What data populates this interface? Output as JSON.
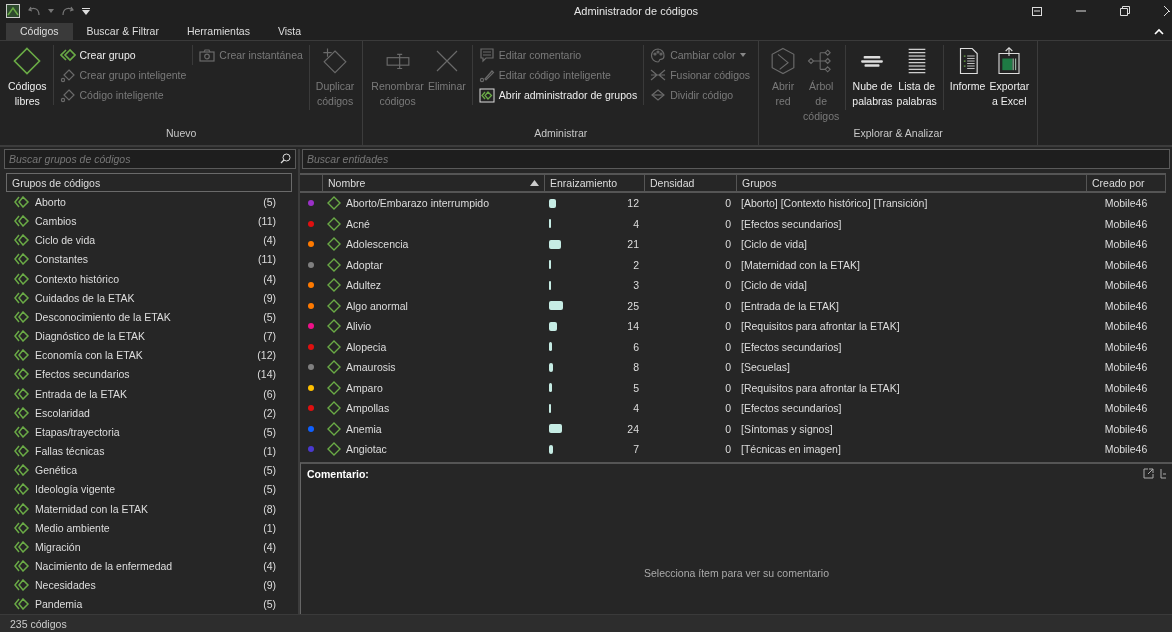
{
  "window": {
    "title": "Administrador de códigos"
  },
  "tabs": [
    {
      "label": "Códigos",
      "selected": true
    },
    {
      "label": "Buscar & Filtrar",
      "selected": false
    },
    {
      "label": "Herramientas",
      "selected": false
    },
    {
      "label": "Vista",
      "selected": false
    }
  ],
  "ribbon": [
    {
      "label": "Nuevo",
      "columns": [
        {
          "kind": "large",
          "items": [
            {
              "label": "Códigos libres",
              "disabled": false
            }
          ]
        },
        {
          "kind": "stack",
          "items": [
            {
              "label": "Crear grupo",
              "disabled": false
            },
            {
              "label": "Crear grupo inteligente",
              "disabled": true
            },
            {
              "label": "Código inteligente",
              "disabled": true
            }
          ]
        },
        {
          "kind": "stack",
          "items": [
            {
              "label": "Crear instantánea",
              "disabled": true
            }
          ]
        },
        {
          "kind": "large",
          "items": [
            {
              "label": "Duplicar códigos",
              "disabled": true
            }
          ]
        }
      ]
    },
    {
      "label": "Administrar",
      "columns": [
        {
          "kind": "large",
          "items": [
            {
              "label": "Renombrar códigos",
              "disabled": true
            },
            {
              "label": "Eliminar",
              "disabled": true
            }
          ]
        },
        {
          "kind": "stack",
          "items": [
            {
              "label": "Editar comentario",
              "disabled": true
            },
            {
              "label": "Editar código inteligente",
              "disabled": true
            },
            {
              "label": "Abrir administrador de grupos",
              "disabled": false
            }
          ]
        },
        {
          "kind": "stack",
          "items": [
            {
              "label": "Cambiar color",
              "disabled": true,
              "dropdown": true
            },
            {
              "label": "Fusionar códigos",
              "disabled": true
            },
            {
              "label": "Dividir código",
              "disabled": true
            }
          ]
        }
      ]
    },
    {
      "label": "Explorar & Analizar",
      "columns": [
        {
          "kind": "large",
          "items": [
            {
              "label": "Abrir red",
              "disabled": true
            },
            {
              "label": "Árbol de códigos",
              "disabled": true
            }
          ]
        },
        {
          "kind": "large",
          "items": [
            {
              "label": "Nube de palabras",
              "disabled": false
            },
            {
              "label": "Lista de palabras",
              "disabled": false
            }
          ]
        },
        {
          "kind": "large",
          "items": [
            {
              "label": "Informe",
              "disabled": false
            },
            {
              "label": "Exportar a Excel",
              "disabled": false
            }
          ]
        }
      ]
    }
  ],
  "groups_panel": {
    "search": {
      "placeholder": "Buscar grupos de códigos"
    },
    "header": "Grupos de códigos",
    "items": [
      {
        "name": "Aborto",
        "count": "(5)"
      },
      {
        "name": "Cambios",
        "count": "(11)"
      },
      {
        "name": "Ciclo de vida",
        "count": "(4)"
      },
      {
        "name": "Constantes",
        "count": "(11)"
      },
      {
        "name": "Contexto histórico",
        "count": "(4)"
      },
      {
        "name": "Cuidados de la ETAK",
        "count": "(9)"
      },
      {
        "name": "Desconocimiento de la ETAK",
        "count": "(5)"
      },
      {
        "name": "Diagnóstico de la ETAK",
        "count": "(7)"
      },
      {
        "name": "Economía con la ETAK",
        "count": "(12)"
      },
      {
        "name": "Efectos secundarios",
        "count": "(14)"
      },
      {
        "name": "Entrada de la ETAK",
        "count": "(6)"
      },
      {
        "name": "Escolaridad",
        "count": "(2)"
      },
      {
        "name": "Etapas/trayectoria",
        "count": "(5)"
      },
      {
        "name": "Fallas técnicas",
        "count": "(1)"
      },
      {
        "name": "Genética",
        "count": "(5)"
      },
      {
        "name": "Ideología vigente",
        "count": "(5)"
      },
      {
        "name": "Maternidad con la ETAK",
        "count": "(8)"
      },
      {
        "name": "Medio ambiente",
        "count": "(1)"
      },
      {
        "name": "Migración",
        "count": "(4)"
      },
      {
        "name": "Nacimiento de la enfermedad",
        "count": "(4)"
      },
      {
        "name": "Necesidades",
        "count": "(9)"
      },
      {
        "name": "Pandemia",
        "count": "(5)"
      }
    ]
  },
  "table": {
    "search": {
      "placeholder": "Buscar entidades"
    },
    "columns": [
      "Nombre",
      "Enraizamiento",
      "Densidad",
      "Grupos",
      "Creado por"
    ],
    "rows": [
      {
        "color": "#9b30c8",
        "name": "Aborto/Embarazo interrumpido",
        "grounded": "12",
        "density": "0",
        "groups": "[Aborto] [Contexto histórico] [Transición]",
        "creator": "Mobile46"
      },
      {
        "color": "#e01010",
        "name": "Acné",
        "grounded": "4",
        "density": "0",
        "groups": "[Efectos secundarios]",
        "creator": "Mobile46"
      },
      {
        "color": "#ff7a00",
        "name": "Adolescencia",
        "grounded": "21",
        "density": "0",
        "groups": "[Ciclo de vida]",
        "creator": "Mobile46"
      },
      {
        "color": "#808080",
        "name": "Adoptar",
        "grounded": "2",
        "density": "0",
        "groups": "[Maternidad con la ETAK]",
        "creator": "Mobile46"
      },
      {
        "color": "#ff7a00",
        "name": "Adultez",
        "grounded": "3",
        "density": "0",
        "groups": "[Ciclo de vida]",
        "creator": "Mobile46"
      },
      {
        "color": "#ff7a00",
        "name": "Algo anormal",
        "grounded": "25",
        "density": "0",
        "groups": "[Entrada de la ETAK]",
        "creator": "Mobile46"
      },
      {
        "color": "#f0108a",
        "name": "Alivio",
        "grounded": "14",
        "density": "0",
        "groups": "[Requisitos para afrontar la ETAK]",
        "creator": "Mobile46"
      },
      {
        "color": "#e01010",
        "name": "Alopecia",
        "grounded": "6",
        "density": "0",
        "groups": "[Efectos secundarios]",
        "creator": "Mobile46"
      },
      {
        "color": "#808080",
        "name": "Amaurosis",
        "grounded": "8",
        "density": "0",
        "groups": "[Secuelas]",
        "creator": "Mobile46"
      },
      {
        "color": "#ffc000",
        "name": "Amparo",
        "grounded": "5",
        "density": "0",
        "groups": "[Requisitos para afrontar la ETAK]",
        "creator": "Mobile46"
      },
      {
        "color": "#e01010",
        "name": "Ampollas",
        "grounded": "4",
        "density": "0",
        "groups": "[Efectos secundarios]",
        "creator": "Mobile46"
      },
      {
        "color": "#1060ff",
        "name": "Anemia",
        "grounded": "24",
        "density": "0",
        "groups": "[Síntomas y signos]",
        "creator": "Mobile46"
      },
      {
        "color": "#4a3ad0",
        "name": "Angiotac",
        "grounded": "7",
        "density": "0",
        "groups": "[Técnicas en imagen]",
        "creator": "Mobile46"
      }
    ]
  },
  "comment": {
    "label": "Comentario:",
    "placeholder": "Selecciona ítem para ver su comentario"
  },
  "status_bar": "235 códigos"
}
